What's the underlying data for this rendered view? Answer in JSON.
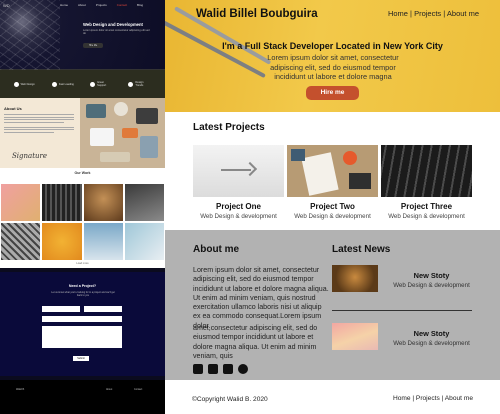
{
  "header": {
    "brand": "Walid Billel Boubguira",
    "nav": {
      "home": "Home",
      "sep1": " | ",
      "projects": "Projects",
      "sep2": " | ",
      "about": "About me"
    }
  },
  "hero": {
    "headline": "I'm a Full Stack Developer Located in New York City",
    "text": "Lorem ipsum dolor sit amet, consectetur adipiscing elit, sed do eiusmod tempor incididunt ut labore et dolore magna",
    "button": "Hire me"
  },
  "projects": {
    "title": "Latest Projects",
    "items": [
      {
        "title": "Project One",
        "subtitle": "Web Design & development"
      },
      {
        "title": "Project Two",
        "subtitle": "Web Design & development"
      },
      {
        "title": "Project Three",
        "subtitle": "Web Design & development"
      }
    ]
  },
  "about": {
    "title": "About me",
    "p1": "Lorem ipsum dolor sit amet, consectetur adipiscing elit, sed do eiusmod tempor incididunt ut labore et dolore magna aliqua. Ut enim ad minim veniam, quis nostrud exercitation ullamco laboris nisi ut aliquip ex ea commodo consequat.Lorem ipsum dolor.",
    "p2": "amet,consectetur adipiscing elit, sed do eiusmod tempor incididunt ut labore et dolore magna aliqua. Ut enim ad minim veniam, quis"
  },
  "news": {
    "title": "Latest News",
    "items": [
      {
        "title": "New Stoty",
        "subtitle": "Web Design & development"
      },
      {
        "title": "New Stoty",
        "subtitle": "Web Design & development"
      }
    ]
  },
  "social": [
    "facebook-icon",
    "linkedin-icon",
    "devto-icon",
    "github-icon"
  ],
  "footer": {
    "copyright": "©Copyright Walid B. 2020",
    "nav": {
      "home": "Home",
      "sep1": " | ",
      "projects": "Projects",
      "sep2": " | ",
      "about": "About me"
    }
  },
  "preview": {
    "logo": "WD",
    "nav": [
      "Home",
      "About",
      "Projects",
      "Contact",
      "Blog"
    ],
    "hero_title": "Web Design and Development",
    "hero_text": "Lorem ipsum dolor sit amet consectetur adipiscing elit sed do",
    "hero_button": "Hire Me",
    "features": [
      "Web Design",
      "Fast Loading",
      "Great Support",
      "Design Trends"
    ],
    "about_title": "About Us",
    "signature": "Signature",
    "work_title": "Our Work",
    "load_more": "Load more",
    "contact_title": "Need a Project?",
    "contact_text": "Let us know what you're looking for in a project and we'll get back to you",
    "send": "Submit",
    "footer_brand": "Walid B.",
    "footer_cols": [
      "Walid B.",
      "About",
      "Contact"
    ]
  },
  "colors": {
    "hero_bg": "#f2c94a",
    "accent": "#c4502d",
    "lower_bg": "#b2b2b2",
    "preview_dark": "#0a0a3a"
  }
}
